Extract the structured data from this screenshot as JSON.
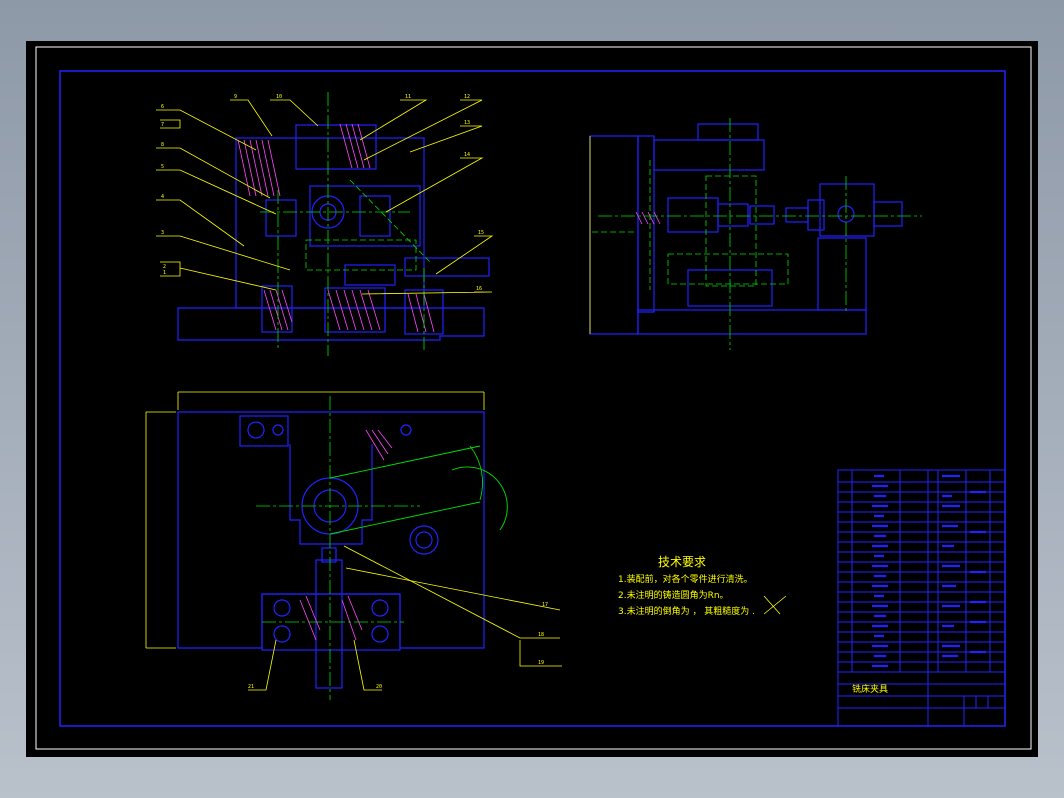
{
  "drawing": {
    "tech_req": {
      "title": "技术要求",
      "lines": [
        "1.装配前，对各个零件进行清洗。",
        "2.未注明的铸造圆角为Rn。",
        "3.未注明的倒角为 ，  其粗糙度为  ."
      ]
    },
    "title_block": {
      "name": "铣床夹具"
    },
    "balloons_top": [
      "6",
      "7",
      "9",
      "10",
      "11",
      "12",
      "13",
      "14",
      "8",
      "5",
      "4",
      "3",
      "2",
      "1",
      "15",
      "16"
    ],
    "balloons_bottom": [
      "17",
      "18",
      "19",
      "21",
      "20"
    ]
  }
}
